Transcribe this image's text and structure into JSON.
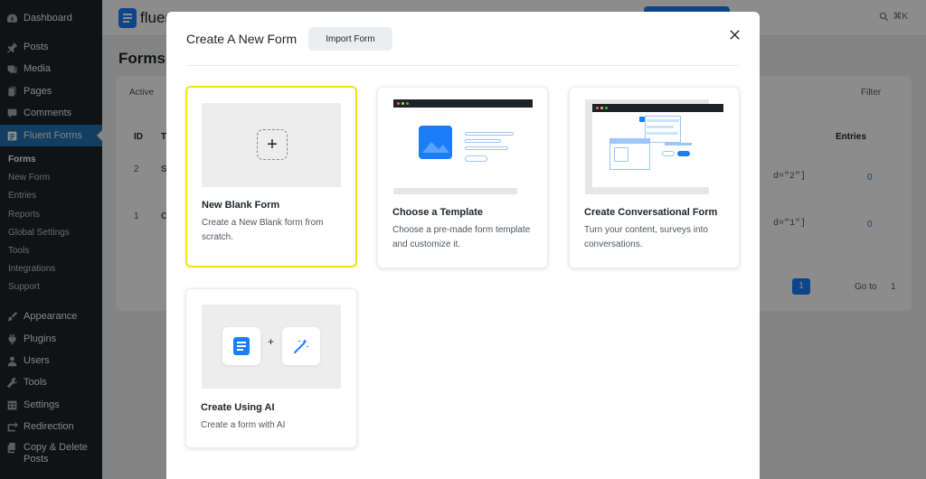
{
  "sidebar": {
    "items": [
      {
        "label": "Dashboard",
        "icon": "dashboard-icon"
      },
      {
        "label": "Posts",
        "icon": "pin-icon"
      },
      {
        "label": "Media",
        "icon": "media-icon"
      },
      {
        "label": "Pages",
        "icon": "pages-icon"
      },
      {
        "label": "Comments",
        "icon": "comment-icon"
      },
      {
        "label": "Fluent Forms",
        "icon": "fluent-forms-icon"
      }
    ],
    "submenu": [
      "Forms",
      "New Form",
      "Entries",
      "Reports",
      "Global Settings",
      "Tools",
      "Integrations",
      "Support"
    ],
    "items_bottom": [
      {
        "label": "Appearance",
        "icon": "brush-icon"
      },
      {
        "label": "Plugins",
        "icon": "plugin-icon"
      },
      {
        "label": "Users",
        "icon": "users-icon"
      },
      {
        "label": "Tools",
        "icon": "wrench-icon"
      },
      {
        "label": "Settings",
        "icon": "settings-icon"
      },
      {
        "label": "Redirection",
        "icon": "redirect-icon"
      },
      {
        "label": "Copy & Delete Posts",
        "icon": "copy-icon"
      }
    ]
  },
  "background": {
    "brand": "fluen",
    "search_shortcut": "⌘K",
    "page_title": "Forms",
    "filter_active": "Active",
    "filter_label": "Filter",
    "col_id": "ID",
    "col_t": "T",
    "col_entries": "Entries",
    "rows": [
      {
        "id": "2",
        "initial": "S",
        "shortcode": "d=\"2\"]",
        "entries": "0"
      },
      {
        "id": "1",
        "initial": "C",
        "shortcode": "d=\"1\"]",
        "entries": "0"
      }
    ],
    "page_num": "1",
    "goto_label": "Go to",
    "goto_value": "1"
  },
  "modal": {
    "title": "Create A New Form",
    "import_label": "Import Form",
    "cards": [
      {
        "title": "New Blank Form",
        "desc": "Create a New Blank form from scratch."
      },
      {
        "title": "Choose a Template",
        "desc": "Choose a pre-made form template and customize it."
      },
      {
        "title": "Create Conversational Form",
        "desc": "Turn your content, surveys into conversations."
      },
      {
        "title": "Create Using AI",
        "desc": "Create a form with AI"
      }
    ],
    "plus_symbol": "+",
    "ai_plus_symbol": "+"
  },
  "colors": {
    "wp_sidebar": "#1d2327",
    "wp_active": "#2271b1",
    "brand_blue": "#1a7efb",
    "selected_border": "#f5e10d"
  }
}
